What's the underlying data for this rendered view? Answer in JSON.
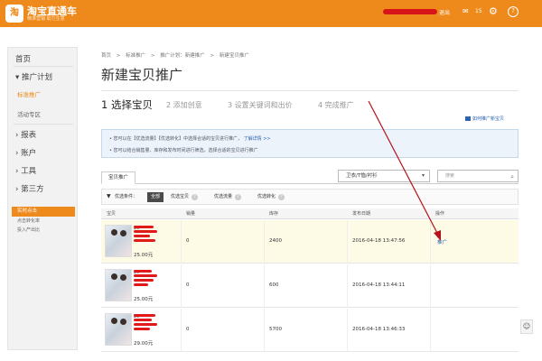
{
  "header": {
    "logo_mark": "淘",
    "logo_title": "淘宝直通车",
    "logo_subtitle": "精准营销 助力生意",
    "logout": "退出",
    "msg_count": "15",
    "icons": {
      "mail": "mail-icon",
      "settings": "gear-icon",
      "help": "help-icon"
    }
  },
  "sidebar": {
    "items": [
      {
        "label": "首页"
      },
      {
        "label": "推广计划"
      },
      {
        "label": "报表"
      },
      {
        "label": "账户"
      },
      {
        "label": "工具"
      },
      {
        "label": "第三方"
      }
    ],
    "subitems": [
      {
        "label": "标准推广",
        "active": true
      },
      {
        "label": "活动专区",
        "active": false
      }
    ],
    "promo": {
      "title": "实时点击",
      "rows": [
        "点击转化率",
        "投入产出比"
      ]
    }
  },
  "breadcrumb": [
    "首页",
    ">",
    "标准推广",
    ">",
    "推广计划：新建推广",
    ">",
    "新建宝贝推广"
  ],
  "page_title": "新建宝贝推广",
  "steps": [
    {
      "label": "1 选择宝贝",
      "active": true
    },
    {
      "label": "2 添加创意",
      "active": false
    },
    {
      "label": "3 设置关键词和出价",
      "active": false
    },
    {
      "label": "4 完成推广",
      "active": false
    }
  ],
  "how_to_link": "如何推广新宝贝",
  "tips": [
    {
      "text": "您可以在【优选流量】【优选转化】中选择合适的宝贝进行推广，",
      "link": "了解详情 >>"
    },
    {
      "text": "您可以结合销售量、库存和发布时间进行筛选，选择合适的宝贝进行推广",
      "link": ""
    }
  ],
  "tab_label": "宝贝推广",
  "category_select": "卫衣/T恤/衬衫",
  "search_placeholder": "搜索",
  "filter": {
    "label": "优选条件：",
    "chips": [
      {
        "label": "全部",
        "active": true
      },
      {
        "label": "优选宝贝",
        "active": false
      },
      {
        "label": "优选流量",
        "active": false
      },
      {
        "label": "优选转化",
        "active": false
      }
    ]
  },
  "table": {
    "columns": [
      "宝贝",
      "销量",
      "库存",
      "发布日期",
      "操作"
    ],
    "rows": [
      {
        "year": "20",
        "price": "25.00元",
        "sales": "0",
        "stock": "2400",
        "date": "2016-04-18 13:47:56",
        "action": "推广"
      },
      {
        "year": "20",
        "price": "25.00元",
        "sales": "0",
        "stock": "600",
        "date": "2016-04-18 13:44:11",
        "action": ""
      },
      {
        "year": "20",
        "price": "29.00元",
        "sales": "0",
        "stock": "5700",
        "date": "2016-04-18 13:46:33",
        "action": ""
      }
    ]
  },
  "colors": {
    "brand": "#ee8a1c",
    "link": "#2a62b4",
    "highlight_row": "#fdfbe6",
    "annotation": "#b5121b"
  }
}
